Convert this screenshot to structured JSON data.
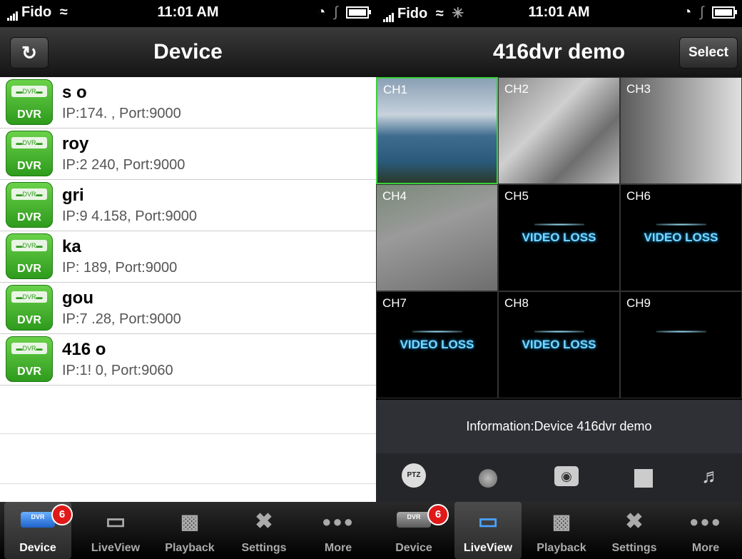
{
  "status_left": {
    "carrier": "Fido",
    "time": "11:01 AM"
  },
  "status_right": {
    "carrier": "Fido",
    "time": "11:01 AM"
  },
  "device_screen": {
    "title": "Device",
    "devices": [
      {
        "name": "s             o",
        "address": "IP:174.              , Port:9000"
      },
      {
        "name": "roy",
        "address": "IP:2                    240, Port:9000"
      },
      {
        "name": "gri",
        "address": "IP:9                  4.158, Port:9000"
      },
      {
        "name": "ka",
        "address": "IP:                    189, Port:9000"
      },
      {
        "name": "gou",
        "address": "IP:7               .28, Port:9000"
      },
      {
        "name": "416             o",
        "address": "IP:1!                  0, Port:9060"
      }
    ],
    "icon_label": "DVR"
  },
  "liveview_screen": {
    "title": "416dvr demo",
    "select_label": "Select",
    "channels": [
      "CH1",
      "CH2",
      "CH3",
      "CH4",
      "CH5",
      "CH6",
      "CH7",
      "CH8",
      "CH9"
    ],
    "video_loss_text": "VIDEO LOSS",
    "info": "Information:Device 416dvr demo",
    "ptz_label": "PTZ"
  },
  "tabs": [
    {
      "label": "Device",
      "icon": "dvr-icon"
    },
    {
      "label": "LiveView",
      "icon": "monitor-icon"
    },
    {
      "label": "Playback",
      "icon": "film-icon"
    },
    {
      "label": "Settings",
      "icon": "tools-icon"
    },
    {
      "label": "More",
      "icon": "more-dots-icon"
    }
  ],
  "badge_count": "6",
  "colors": {
    "accent_green": "#2d9a1c",
    "selection_green": "#38d13a",
    "badge_red": "#e01818"
  }
}
